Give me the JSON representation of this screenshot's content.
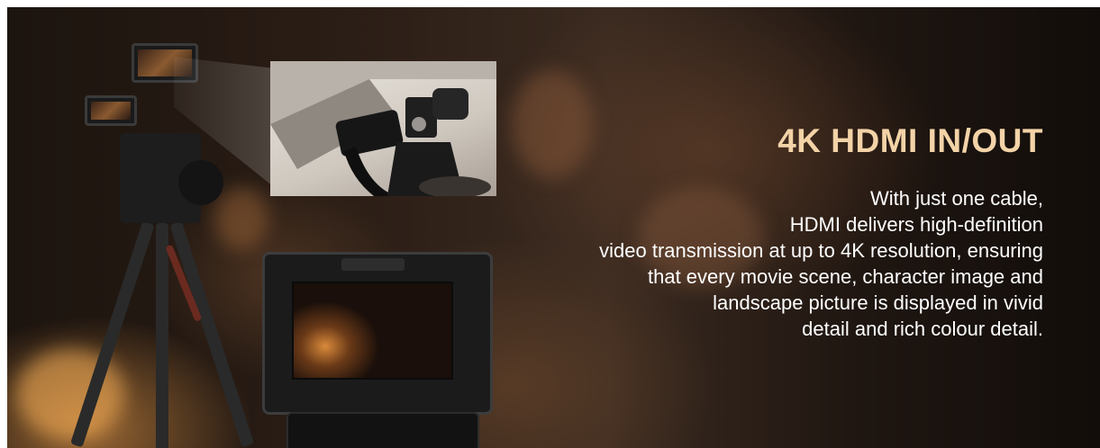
{
  "banner": {
    "headline": "4K HDMI IN/OUT",
    "body_lines": [
      "With just one cable,",
      "HDMI delivers high-definition",
      "video transmission at up to 4K resolution, ensuring",
      "that every movie scene, character image and",
      "landscape picture is displayed in vivid",
      "detail and rich colour detail."
    ]
  },
  "colors": {
    "headline": "#f3d3a7",
    "body_text": "#ffffff",
    "background": "#2a1d15"
  }
}
